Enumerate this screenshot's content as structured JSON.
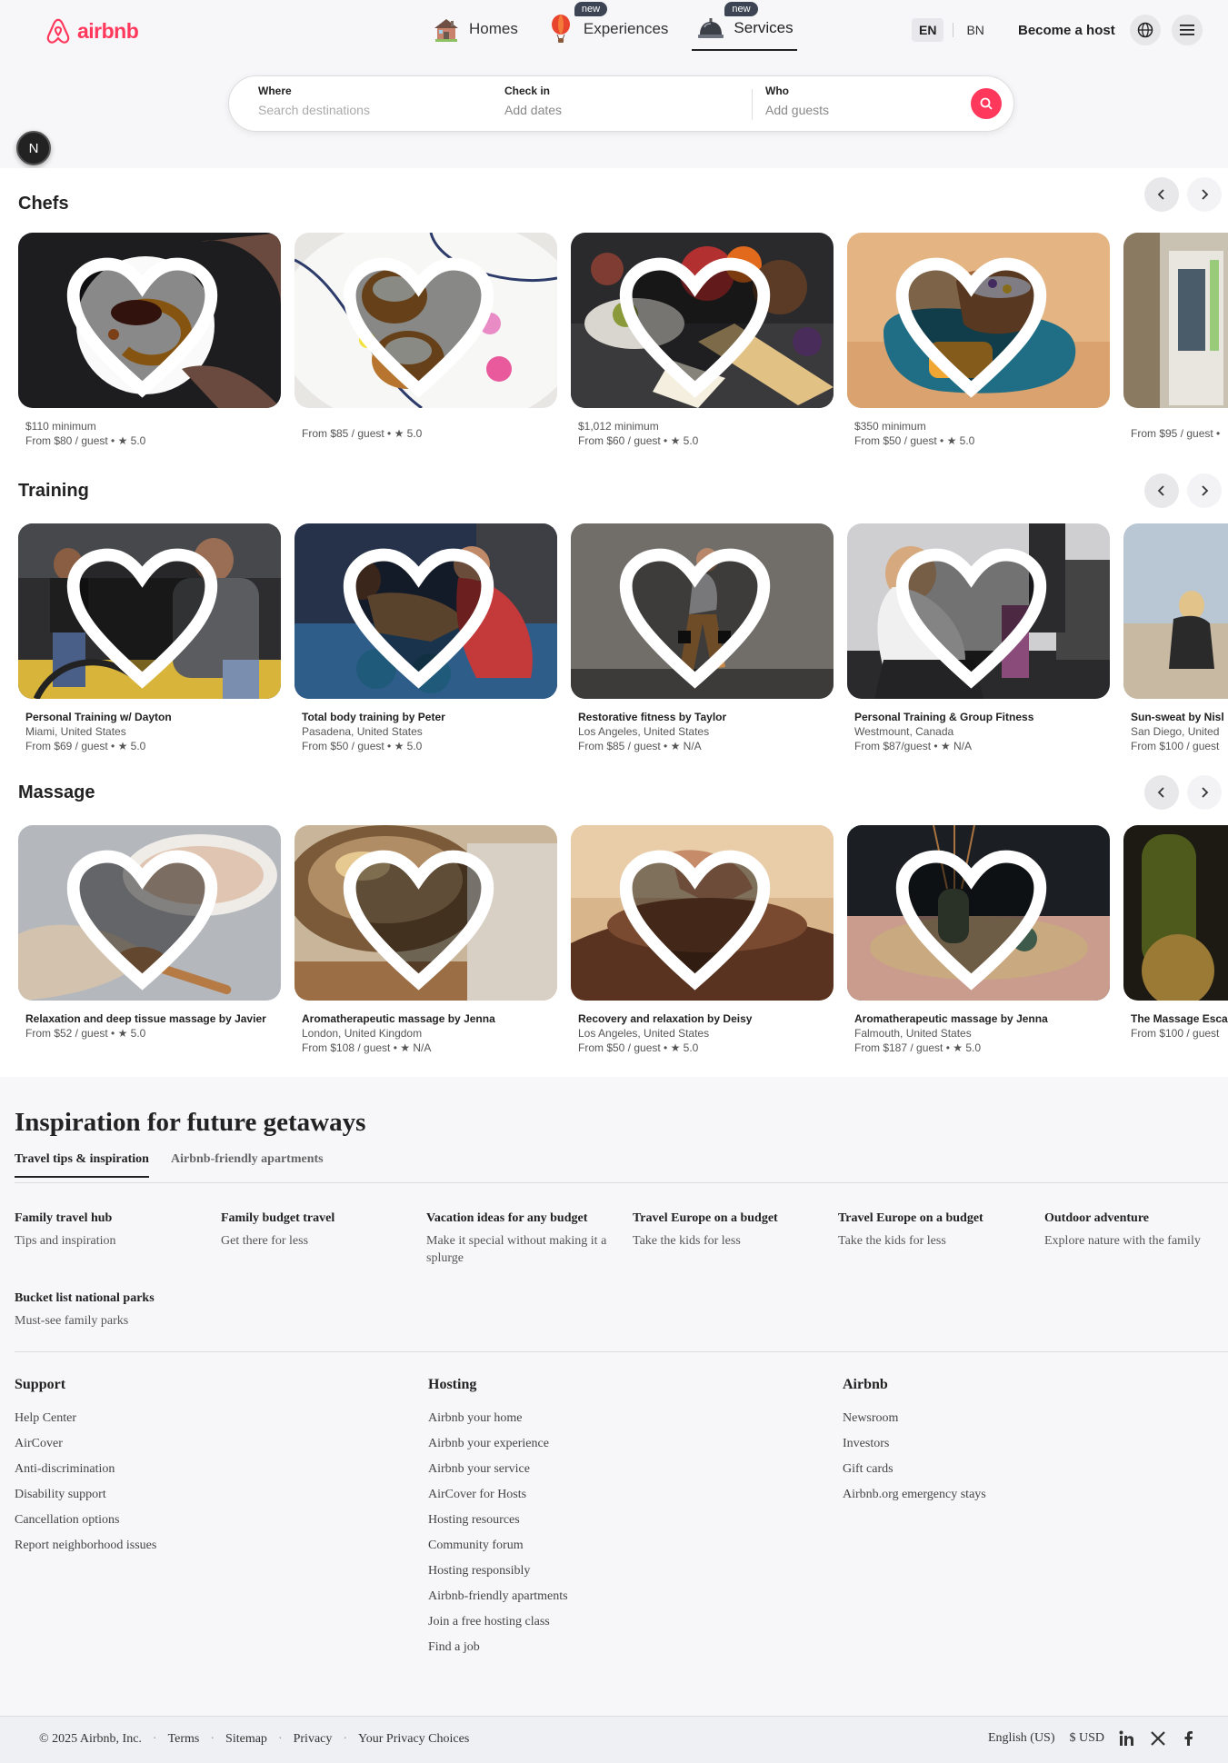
{
  "header": {
    "brand": "airbnb",
    "nav": [
      {
        "label": "Homes",
        "badge": "",
        "icon": "house-icon"
      },
      {
        "label": "Experiences",
        "badge": "new",
        "icon": "balloon-icon"
      },
      {
        "label": "Services",
        "badge": "new",
        "icon": "service-bell-icon"
      }
    ],
    "active_nav": "Services",
    "lang_en": "EN",
    "lang_bn": "BN",
    "become_host": "Become a host"
  },
  "search": {
    "where_label": "Where",
    "where_placeholder": "Search destinations",
    "checkin_label": "Check in",
    "checkin_value": "Add dates",
    "who_label": "Who",
    "who_value": "Add guests"
  },
  "dev_badge": "N",
  "sections": [
    {
      "title": "Chefs",
      "cards": [
        {
          "line1": "$110 minimum",
          "line2": "From $80 / guest • ★ 5.0",
          "line3": ""
        },
        {
          "line1": "",
          "line2": "From $85 / guest • ★ 5.0",
          "line3": ""
        },
        {
          "line1": "$1,012 minimum",
          "line2": "From $60 / guest • ★ 5.0",
          "line3": ""
        },
        {
          "line1": "$350 minimum",
          "line2": "From $50 / guest • ★ 5.0",
          "line3": ""
        },
        {
          "line1": "",
          "line2": "From $95 / guest •",
          "line3": ""
        }
      ]
    },
    {
      "title": "Training",
      "cards": [
        {
          "line1": "Personal Training w/ Dayton",
          "line2": "Miami, United States",
          "line3": "From $69 / guest • ★ 5.0"
        },
        {
          "line1": "Total body training by Peter",
          "line2": "Pasadena, United States",
          "line3": "From $50 / guest • ★ 5.0"
        },
        {
          "line1": "Restorative fitness by Taylor",
          "line2": "Los Angeles, United States",
          "line3": "From $85 / guest • ★ N/A"
        },
        {
          "line1": "Personal Training & Group Fitness",
          "line2": "Westmount, Canada",
          "line3": "From $87/guest • ★ N/A"
        },
        {
          "line1": "Sun-sweat by Nisl",
          "line2": "San Diego, United",
          "line3": "From $100 / guest"
        }
      ]
    },
    {
      "title": "Massage",
      "cards": [
        {
          "line1": "Relaxation and deep tissue massage by Javier",
          "line2": "From $52 / guest • ★ 5.0",
          "line3": ""
        },
        {
          "line1": "Aromatherapeutic massage by Jenna",
          "line2": "London, United Kingdom",
          "line3": "From $108 / guest • ★ N/A"
        },
        {
          "line1": "Recovery and relaxation by Deisy",
          "line2": "Los Angeles, United States",
          "line3": "From $50 / guest • ★ 5.0"
        },
        {
          "line1": "Aromatherapeutic massage by Jenna",
          "line2": "Falmouth, United States",
          "line3": "From $187 / guest • ★ 5.0"
        },
        {
          "line1": "The Massage Esca",
          "line2": "From $100 / guest",
          "line3": ""
        }
      ]
    }
  ],
  "inspiration": {
    "title": "Inspiration for future getaways",
    "tabs": [
      "Travel tips & inspiration",
      "Airbnb-friendly apartments"
    ],
    "items": [
      {
        "title": "Family travel hub",
        "sub": "Tips and inspiration"
      },
      {
        "title": "Family budget travel",
        "sub": "Get there for less"
      },
      {
        "title": "Vacation ideas for any budget",
        "sub": "Make it special without making it a splurge"
      },
      {
        "title": "Travel Europe on a budget",
        "sub": "Take the kids for less"
      },
      {
        "title": "Travel Europe on a budget",
        "sub": "Take the kids for less"
      },
      {
        "title": "Outdoor adventure",
        "sub": "Explore nature with the family"
      },
      {
        "title": "Bucket list national parks",
        "sub": "Must-see family parks"
      }
    ]
  },
  "footer": {
    "support": {
      "title": "Support",
      "links": [
        "Help Center",
        "AirCover",
        "Anti-discrimination",
        "Disability support",
        "Cancellation options",
        "Report neighborhood issues"
      ]
    },
    "hosting": {
      "title": "Hosting",
      "links": [
        "Airbnb your home",
        "Airbnb your experience",
        "Airbnb your service",
        "AirCover for Hosts",
        "Hosting resources",
        "Community forum",
        "Hosting responsibly",
        "Airbnb-friendly apartments",
        "Join a free hosting class",
        "Find a job"
      ]
    },
    "airbnb": {
      "title": "Airbnb",
      "links": [
        "Newsroom",
        "Investors",
        "Gift cards",
        "Airbnb.org emergency stays"
      ]
    }
  },
  "bottom": {
    "copyright": "© 2025 Airbnb, Inc.",
    "links": [
      "Terms",
      "Sitemap",
      "Privacy",
      "Your Privacy Choices"
    ],
    "language": "English (US)",
    "currency": "$ USD",
    "social": [
      "linkedin-icon",
      "x-icon",
      "facebook-icon"
    ]
  },
  "colors": {
    "brand": "#ff385c",
    "badge": "#3d4554"
  }
}
